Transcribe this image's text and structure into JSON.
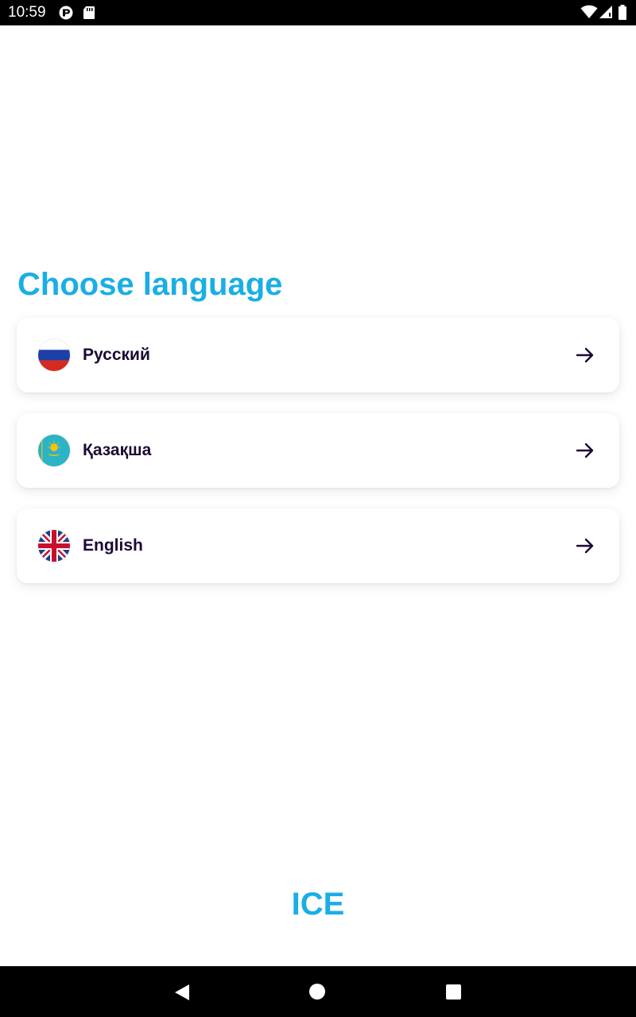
{
  "status_bar": {
    "time": "10:59"
  },
  "screen": {
    "title": "Choose language",
    "languages": [
      {
        "label": "Русский",
        "flag": "russia-flag-icon"
      },
      {
        "label": "Қазақша",
        "flag": "kazakhstan-flag-icon"
      },
      {
        "label": "English",
        "flag": "uk-flag-icon"
      }
    ],
    "brand": "ICE"
  },
  "colors": {
    "accent": "#1aaee5",
    "text_dark": "#1b0a33",
    "background": "#ffffff"
  },
  "nav_bar": {
    "icons": [
      "back-icon",
      "home-icon",
      "recents-icon"
    ]
  }
}
